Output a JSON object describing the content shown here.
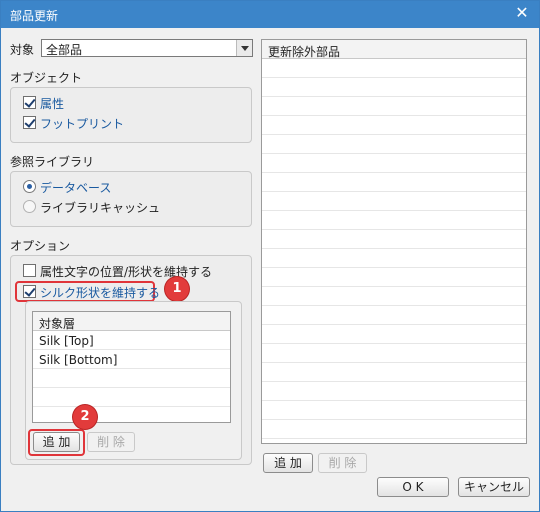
{
  "window": {
    "title": "部品更新",
    "close_glyph": "✕"
  },
  "target": {
    "label": "対象",
    "value": "全部品"
  },
  "object_section": {
    "heading": "オブジェクト",
    "items": [
      {
        "label": "属性",
        "checked": true
      },
      {
        "label": "フットプリント",
        "checked": true
      }
    ]
  },
  "library_section": {
    "heading": "参照ライブラリ",
    "items": [
      {
        "label": "データベース",
        "selected": true
      },
      {
        "label": "ライブラリキャッシュ",
        "selected": false
      }
    ]
  },
  "option_section": {
    "heading": "オプション",
    "items": [
      {
        "label": "属性文字の位置/形状を維持する",
        "checked": false
      },
      {
        "label": "シルク形状を維持する",
        "checked": true
      }
    ],
    "layer_list": {
      "header": "対象層",
      "rows": [
        "Silk [Top]",
        "Silk [Bottom]"
      ]
    },
    "add_label": "追 加",
    "delete_label": "削 除"
  },
  "right_list": {
    "header": "更新除外部品",
    "add_label": "追 加",
    "delete_label": "削 除"
  },
  "footer": {
    "ok_label": "O K",
    "cancel_label": "キャンセル"
  },
  "callouts": [
    "1",
    "2"
  ],
  "colors": {
    "titlebar": "#3c85c9",
    "highlight": "#e0353a",
    "link_text": "#1a5aa0"
  }
}
